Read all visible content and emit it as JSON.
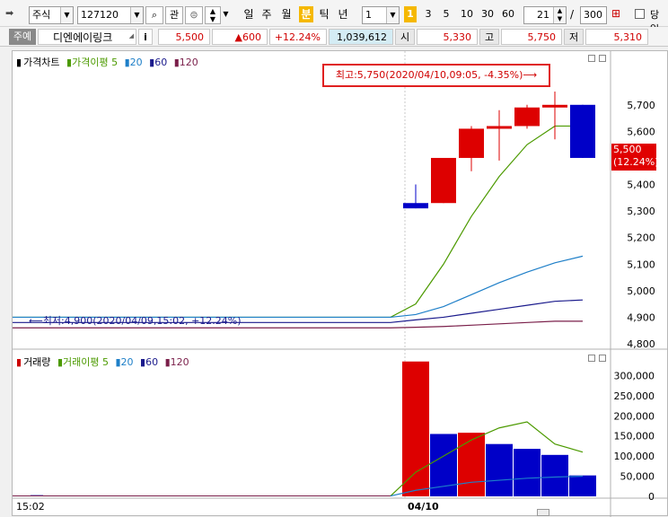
{
  "toolbar": {
    "market_type": "주식",
    "stock_code": "127120",
    "watch_label": "관",
    "periods": [
      "일",
      "주",
      "월",
      "분",
      "틱",
      "년"
    ],
    "selected_period": "분",
    "period_count": "1",
    "minute_options": [
      "1",
      "3",
      "5",
      "10",
      "30",
      "60"
    ],
    "selected_minute": "1",
    "display_count": "21",
    "total_count": "300",
    "slash": "/",
    "today_label": "당일"
  },
  "quote": {
    "exchange_tab": "주예",
    "name": "디엔에이링크",
    "info_label": "i",
    "price": "5,500",
    "change": "▲600",
    "change_rate": "+12.24%",
    "volume": "1,039,612",
    "open_label": "시",
    "open": "5,330",
    "high_label": "고",
    "high": "5,750",
    "low_label": "저",
    "low": "5,310"
  },
  "price_chart": {
    "legend": [
      {
        "text": "가격차트",
        "color": "#000000"
      },
      {
        "text": "가격이평 5",
        "color": "#4c9a00"
      },
      {
        "text": "20",
        "color": "#1e7fc8"
      },
      {
        "text": "60",
        "color": "#1a1a8c"
      },
      {
        "text": "120",
        "color": "#7a1f4a"
      }
    ],
    "y_ticks": [
      "5,700",
      "5,600",
      "5,500",
      "5,400",
      "5,300",
      "5,200",
      "5,100",
      "5,000",
      "4,900",
      "4,800"
    ],
    "current_price_tag": "5,500",
    "current_rate_tag": "(12.24%)",
    "high_annotation": "최고:5,750(2020/04/10,09:05, -4.35%)⟶",
    "low_annotation": "⟵최저:4,900(2020/04/09,15:02, +12.24%)"
  },
  "volume_chart": {
    "legend": [
      {
        "text": "거래량",
        "color": "#cc0000"
      },
      {
        "text": "거래이평 5",
        "color": "#4c9a00"
      },
      {
        "text": "20",
        "color": "#1e7fc8"
      },
      {
        "text": "60",
        "color": "#1a1a8c"
      },
      {
        "text": "120",
        "color": "#7a1f4a"
      }
    ],
    "y_ticks": [
      "300,000",
      "250,000",
      "200,000",
      "150,000",
      "100,000",
      "50,000",
      "0"
    ]
  },
  "x_axis": {
    "labels": [
      "15:02",
      "04/10"
    ]
  },
  "chart_data": [
    {
      "type": "candlestick",
      "title": "가격차트",
      "ylim": [
        4800,
        5750
      ],
      "candles": [
        {
          "open": 5310,
          "high": 5400,
          "low": 5310,
          "close": 5330,
          "color": "blue"
        },
        {
          "open": 5330,
          "high": 5500,
          "low": 5330,
          "close": 5500,
          "color": "red"
        },
        {
          "open": 5500,
          "high": 5620,
          "low": 5450,
          "close": 5610,
          "color": "red"
        },
        {
          "open": 5610,
          "high": 5680,
          "low": 5490,
          "close": 5620,
          "color": "red"
        },
        {
          "open": 5620,
          "high": 5700,
          "low": 5610,
          "close": 5690,
          "color": "red"
        },
        {
          "open": 5690,
          "high": 5750,
          "low": 5570,
          "close": 5700,
          "color": "red"
        },
        {
          "open": 5700,
          "high": 5700,
          "low": 5500,
          "close": 5500,
          "color": "blue"
        }
      ],
      "series": [
        {
          "name": "5",
          "color": "#4c9a00",
          "values": [
            4900,
            4950,
            5100,
            5280,
            5430,
            5550,
            5620,
            5620
          ]
        },
        {
          "name": "20",
          "color": "#1e7fc8",
          "values": [
            4900,
            4910,
            4940,
            4985,
            5030,
            5070,
            5105,
            5130
          ]
        },
        {
          "name": "60",
          "color": "#1a1a8c",
          "values": [
            4880,
            4890,
            4900,
            4915,
            4930,
            4945,
            4960,
            4965
          ]
        },
        {
          "name": "120",
          "color": "#7a1f4a",
          "values": [
            4860,
            4862,
            4865,
            4870,
            4875,
            4880,
            4885,
            4885
          ]
        }
      ]
    },
    {
      "type": "bar",
      "title": "거래량",
      "ylim": [
        0,
        330000
      ],
      "values": [
        335000,
        155000,
        158000,
        130000,
        118000,
        103000,
        52000
      ],
      "colors": [
        "red",
        "blue",
        "red",
        "blue",
        "blue",
        "blue",
        "blue"
      ],
      "series": [
        {
          "name": "5",
          "color": "#4c9a00",
          "values": [
            1000,
            60000,
            100000,
            140000,
            170000,
            185000,
            130000,
            110000
          ]
        },
        {
          "name": "20",
          "color": "#1e7fc8",
          "values": [
            1000,
            15000,
            25000,
            35000,
            40000,
            45000,
            48000,
            50000
          ]
        }
      ]
    }
  ]
}
